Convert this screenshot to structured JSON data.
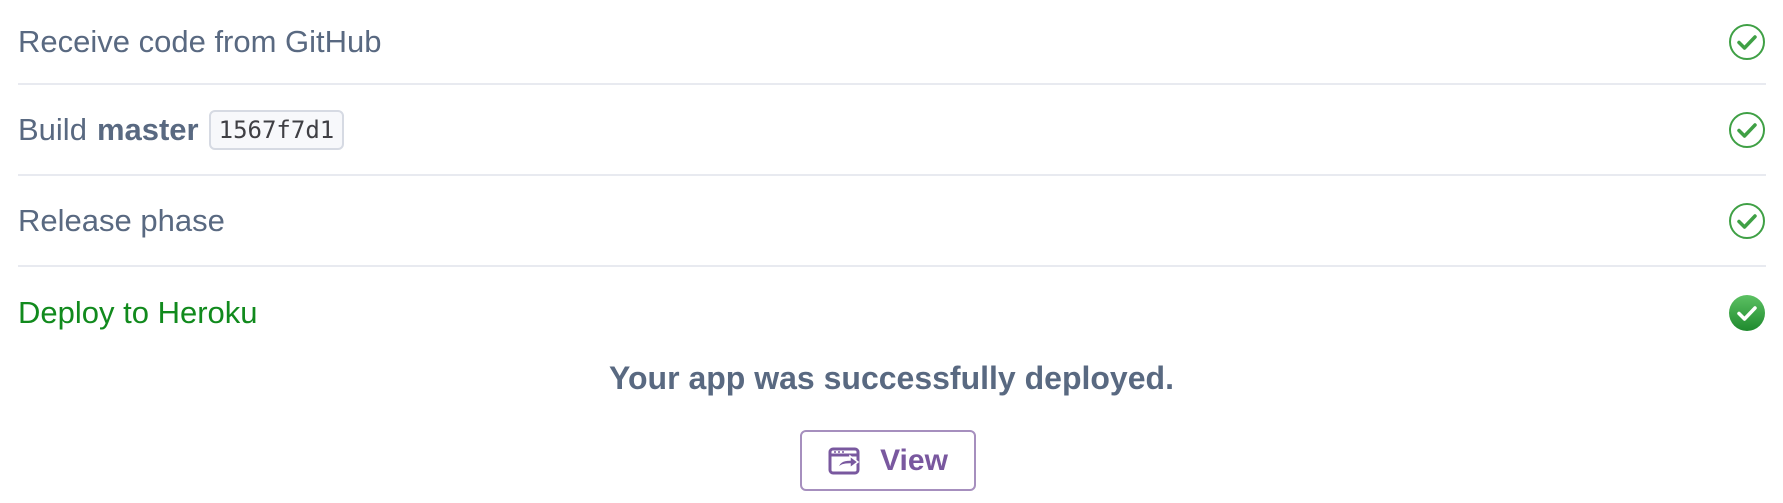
{
  "steps": [
    {
      "label": "Receive code from GitHub",
      "status": "done"
    },
    {
      "label": "Build",
      "branch": "master",
      "commit": "1567f7d1",
      "status": "done"
    },
    {
      "label": "Release phase",
      "status": "done"
    },
    {
      "label": "Deploy to Heroku",
      "status": "success"
    }
  ],
  "result": {
    "message": "Your app was successfully deployed.",
    "view_label": "View"
  },
  "colors": {
    "text": "#596981",
    "success": "#118a1d",
    "check_outline": "#3fa045",
    "button_accent": "#79589f",
    "button_border": "#a68fbe",
    "divider": "#e8eaf0"
  },
  "icons": {
    "step_done": "check-circle-outline-icon",
    "step_success": "check-circle-filled-icon",
    "view": "open-window-icon"
  }
}
